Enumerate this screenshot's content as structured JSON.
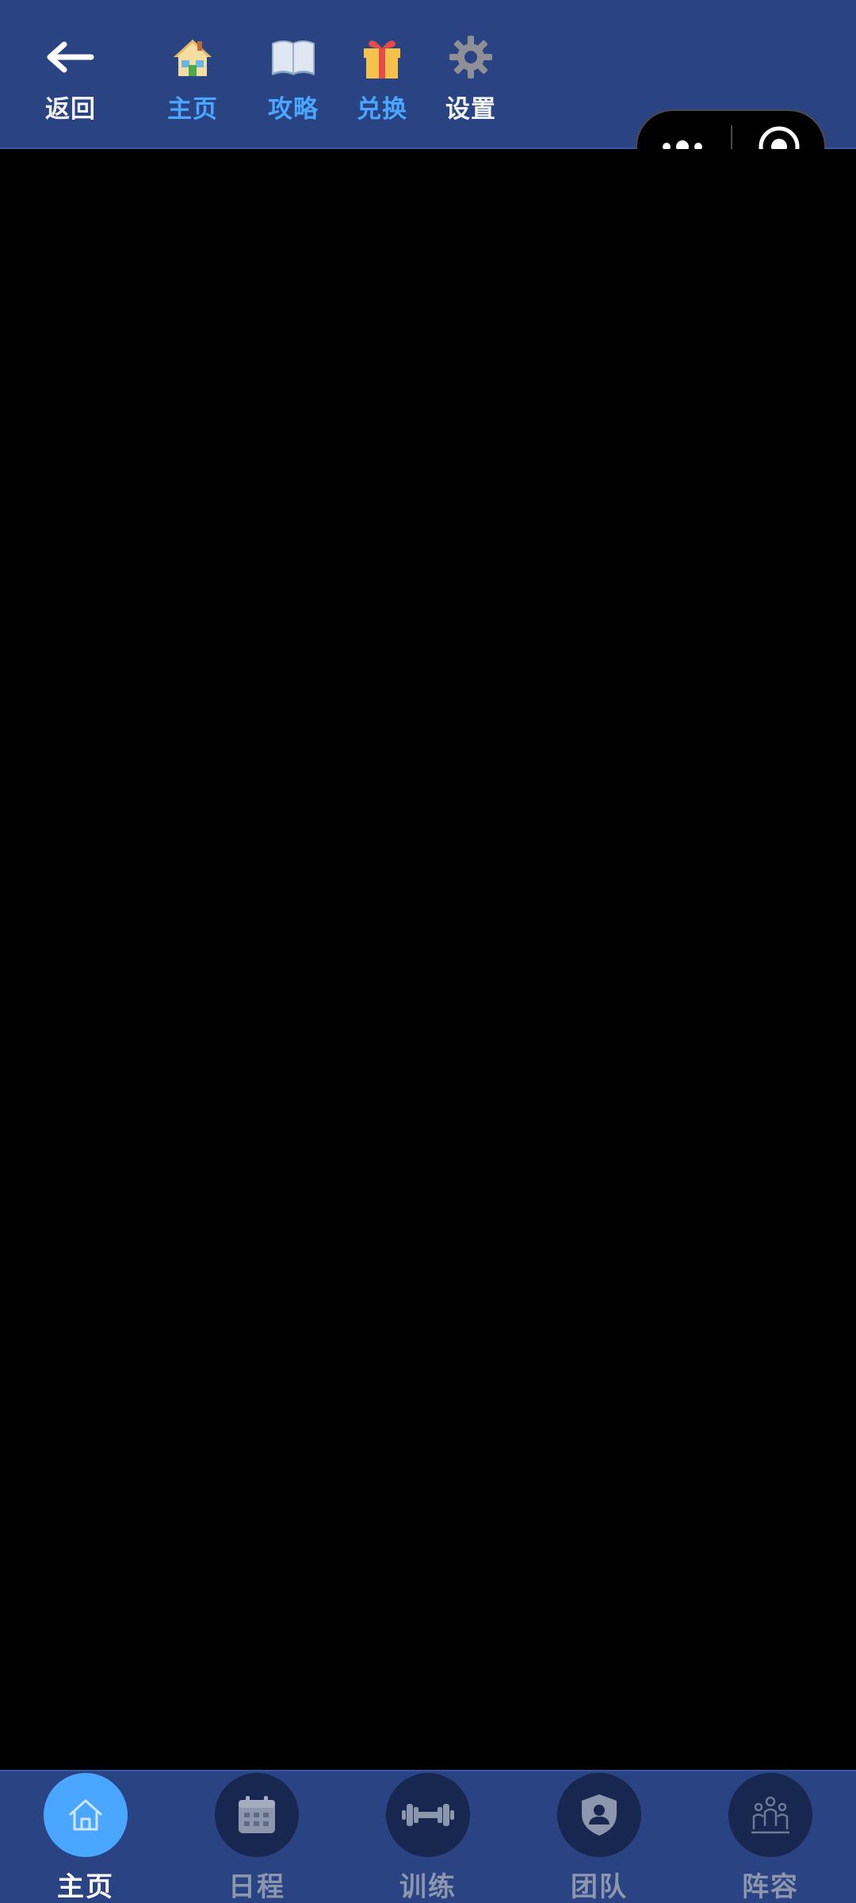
{
  "top_nav": {
    "back": {
      "label": "返回",
      "icon": "arrow-left-icon"
    },
    "items": [
      {
        "label": "主页",
        "icon": "house-icon"
      },
      {
        "label": "攻略",
        "icon": "book-icon"
      },
      {
        "label": "兑换",
        "icon": "gift-icon"
      },
      {
        "label": "设置",
        "icon": "gear-icon"
      }
    ]
  },
  "capsule": {
    "more_icon": "more-dots-icon",
    "close_icon": "target-close-icon"
  },
  "bottom_tabs": [
    {
      "label": "主页",
      "icon": "home-icon",
      "active": true
    },
    {
      "label": "日程",
      "icon": "calendar-icon",
      "active": false
    },
    {
      "label": "训练",
      "icon": "dumbbell-icon",
      "active": false
    },
    {
      "label": "团队",
      "icon": "shield-user-icon",
      "active": false
    },
    {
      "label": "阵容",
      "icon": "group-icon",
      "active": false
    }
  ],
  "colors": {
    "bar_background": "#2a4383",
    "content_background": "#000000",
    "accent_blue": "#4aa6ff",
    "tab_circle": "#17274f",
    "inactive_label": "#8c96ad"
  }
}
